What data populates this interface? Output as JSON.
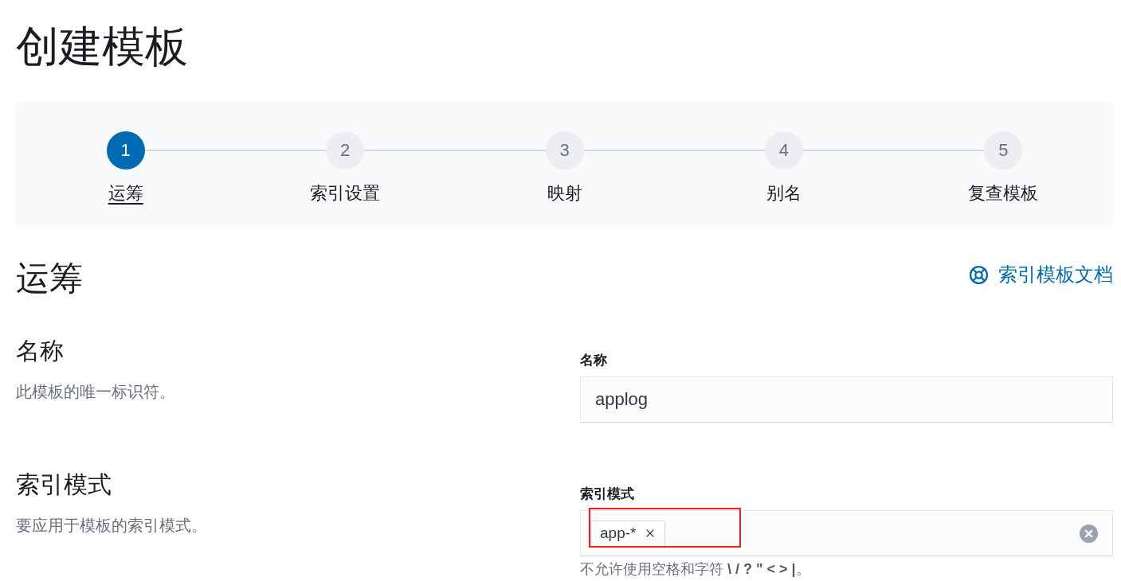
{
  "page": {
    "title": "创建模板"
  },
  "steps": [
    {
      "number": "1",
      "label": "运筹",
      "selected": true
    },
    {
      "number": "2",
      "label": "索引设置",
      "selected": false
    },
    {
      "number": "3",
      "label": "映射",
      "selected": false
    },
    {
      "number": "4",
      "label": "别名",
      "selected": false
    },
    {
      "number": "5",
      "label": "复查模板",
      "selected": false
    }
  ],
  "section": {
    "title": "运筹",
    "doc_link": {
      "label": "索引模板文档"
    }
  },
  "fields": [
    {
      "kind": "text",
      "title": "名称",
      "description": "此模板的唯一标识符。",
      "label": "名称",
      "value": "applog"
    },
    {
      "kind": "combo",
      "title": "索引模式",
      "description": "要应用于模板的索引模式。",
      "label": "索引模式",
      "tags": [
        {
          "label": "app-*"
        }
      ],
      "annotation_box": true,
      "help": "不允许使用空格和字符 **\\ / ? \" < > |**。"
    }
  ]
}
